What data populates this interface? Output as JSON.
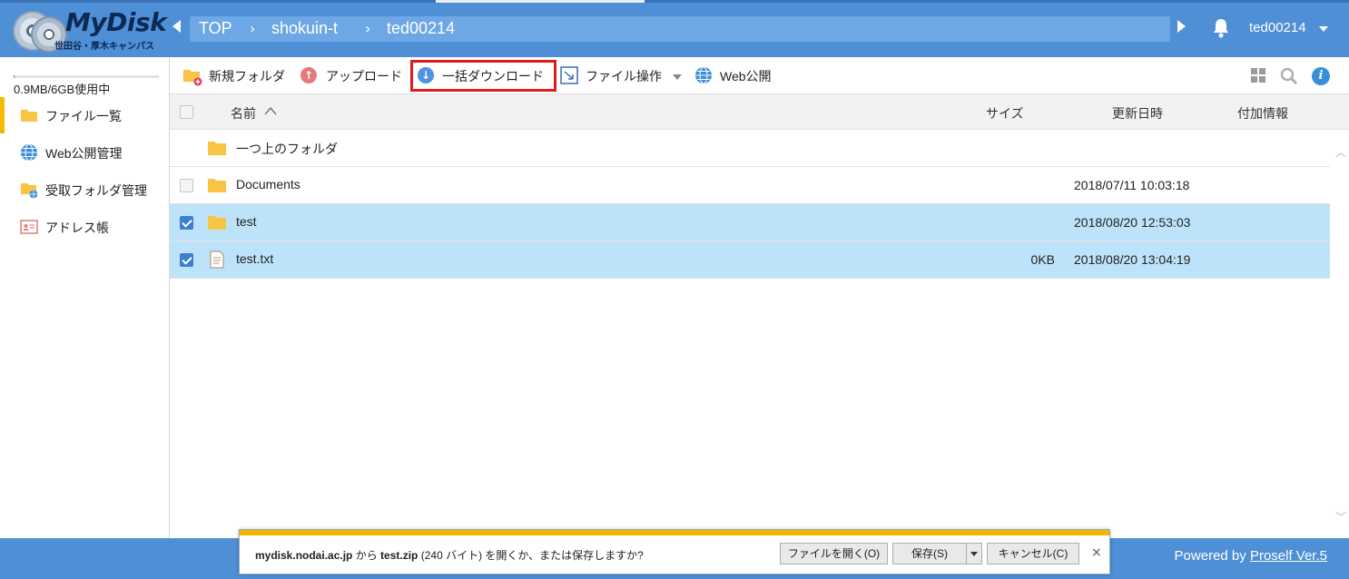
{
  "header": {
    "brand": "MyDisk",
    "campus": "世田谷・厚木キャンパス",
    "breadcrumb": [
      "TOP",
      "shokuin-t",
      "ted00214"
    ],
    "user": "ted00214"
  },
  "sidebar": {
    "usage_text": "0.9MB/6GB使用中",
    "usage_fraction": 0.00015,
    "items": [
      {
        "label": "ファイル一覧",
        "icon": "folder-icon",
        "active": true
      },
      {
        "label": "Web公開管理",
        "icon": "globe-icon",
        "active": false
      },
      {
        "label": "受取フォルダ管理",
        "icon": "inbox-folder-icon",
        "active": false
      },
      {
        "label": "アドレス帳",
        "icon": "address-book-icon",
        "active": false
      }
    ]
  },
  "toolbar": {
    "new_folder": "新規フォルダ",
    "upload": "アップロード",
    "bulk_download": "一括ダウンロード",
    "file_ops": "ファイル操作",
    "web_publish": "Web公開"
  },
  "table": {
    "columns": {
      "name": "名前",
      "size": "サイズ",
      "updated": "更新日時",
      "info": "付加情報"
    },
    "rows": [
      {
        "name": "一つ上のフォルダ",
        "size": "",
        "updated": "",
        "type": "folder",
        "selected": false
      },
      {
        "name": "Documents",
        "size": "",
        "updated": "2018/07/11 10:03:18",
        "type": "folder",
        "selected": false
      },
      {
        "name": "test",
        "size": "",
        "updated": "2018/08/20 12:53:03",
        "type": "folder",
        "selected": true
      },
      {
        "name": "test.txt",
        "size": "0KB",
        "updated": "2018/08/20 13:04:19",
        "type": "file",
        "selected": true
      }
    ]
  },
  "footer": {
    "powered_prefix": "Powered by",
    "powered_link": "Proself Ver.5"
  },
  "download_bar": {
    "host": "mydisk.nodai.ac.jp",
    "from": " から ",
    "file": "test.zip",
    "rest": " (240 バイト) を開くか、または保存しますか?",
    "open_btn": "ファイルを開く(O)",
    "save_btn": "保存(S)",
    "cancel_btn": "キャンセル(C)",
    "close": "×"
  },
  "colors": {
    "header_bg": "#4f8fd6",
    "breadcrumb_bg": "#6ea7e6",
    "selected_row": "#bde3fb",
    "highlight_border": "#e01b1b",
    "accent_yellow": "#f2b600"
  }
}
